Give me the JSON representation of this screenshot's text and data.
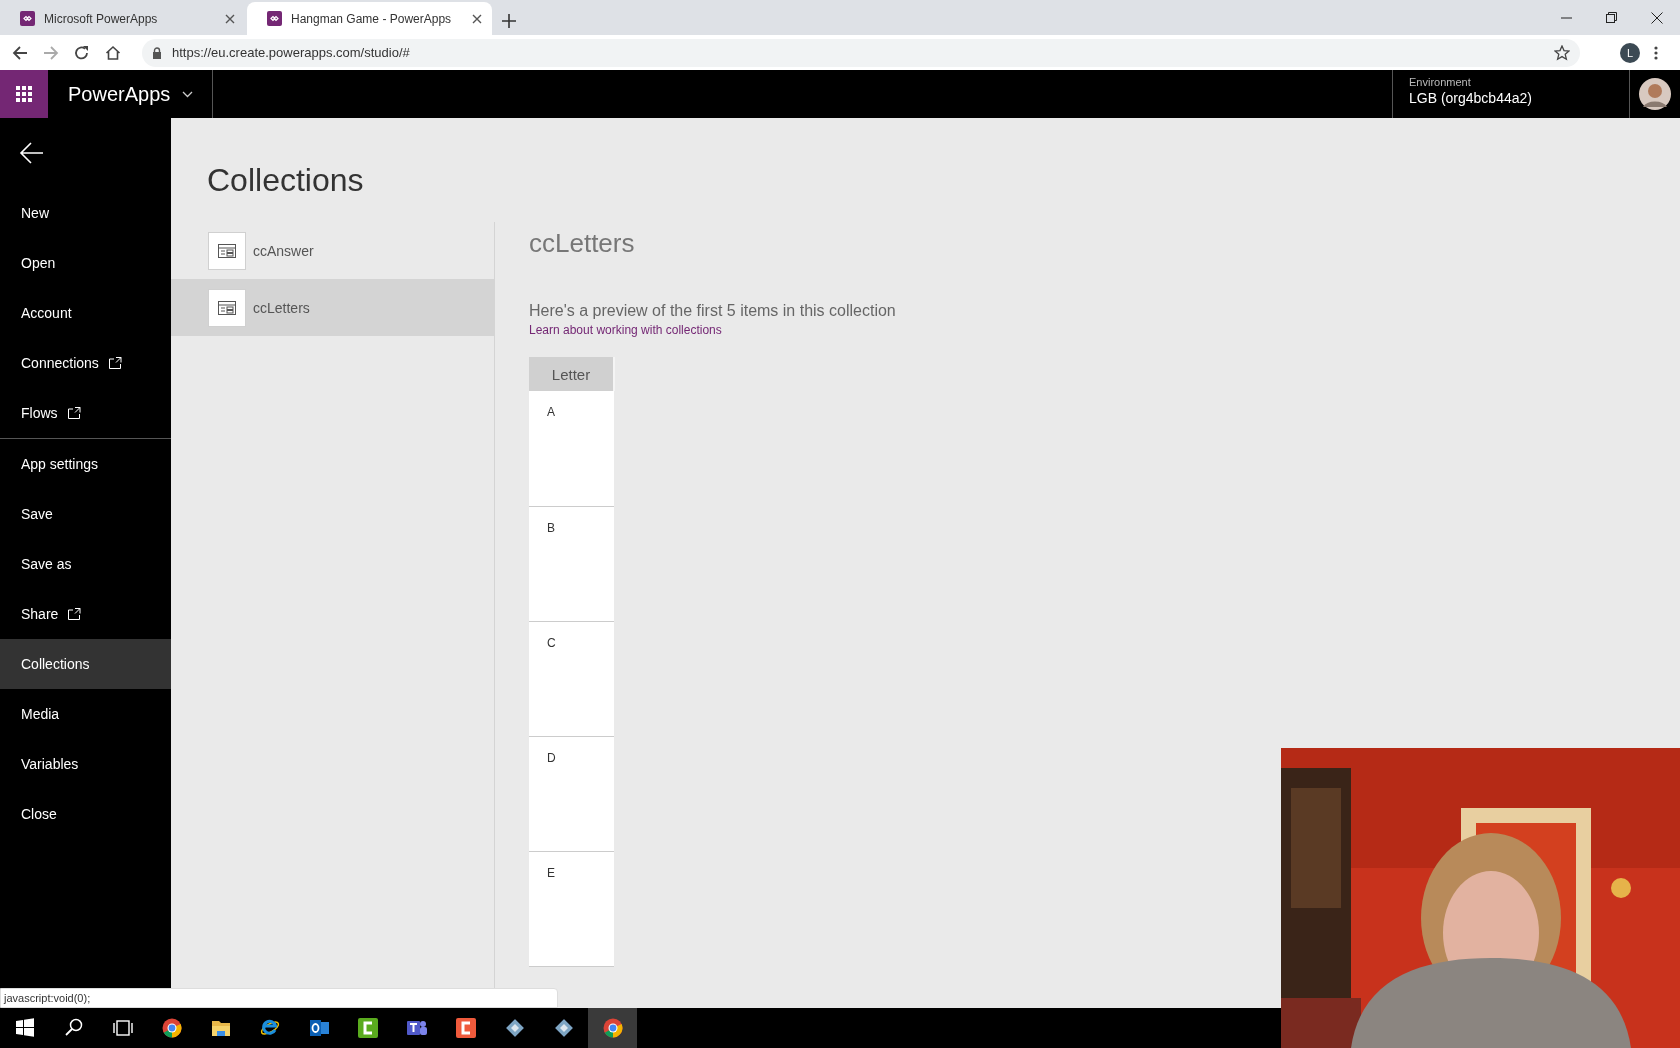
{
  "browser": {
    "tabs": [
      {
        "title": "Microsoft PowerApps",
        "selected": false
      },
      {
        "title": "Hangman Game - PowerApps",
        "selected": true
      }
    ],
    "url": "https://eu.create.powerapps.com/studio/#",
    "profile_initial": "L"
  },
  "header": {
    "app_name": "PowerApps",
    "environment_label": "Environment",
    "environment": "LGB (org4bcb44a2)"
  },
  "sidebar": {
    "groups": [
      [
        {
          "label": "New",
          "external": false,
          "selected": false
        },
        {
          "label": "Open",
          "external": false,
          "selected": false
        },
        {
          "label": "Account",
          "external": false,
          "selected": false
        },
        {
          "label": "Connections",
          "external": true,
          "selected": false
        },
        {
          "label": "Flows",
          "external": true,
          "selected": false
        }
      ],
      [
        {
          "label": "App settings",
          "external": false,
          "selected": false
        },
        {
          "label": "Save",
          "external": false,
          "selected": false
        },
        {
          "label": "Save as",
          "external": false,
          "selected": false
        },
        {
          "label": "Share",
          "external": true,
          "selected": false
        },
        {
          "label": "Collections",
          "external": false,
          "selected": true
        },
        {
          "label": "Media",
          "external": false,
          "selected": false
        },
        {
          "label": "Variables",
          "external": false,
          "selected": false
        },
        {
          "label": "Close",
          "external": false,
          "selected": false
        }
      ]
    ]
  },
  "page": {
    "title": "Collections",
    "collections": [
      {
        "name": "ccAnswer",
        "selected": false
      },
      {
        "name": "ccLetters",
        "selected": true
      }
    ],
    "detail": {
      "title": "ccLetters",
      "description": "Here's a preview of the first 5 items in this collection",
      "link": "Learn about working with collections",
      "columns": [
        "Letter"
      ],
      "rows": [
        [
          "A"
        ],
        [
          "B"
        ],
        [
          "C"
        ],
        [
          "D"
        ],
        [
          "E"
        ]
      ]
    }
  },
  "status_text": "javascript:void(0);",
  "taskbar": {
    "apps": [
      {
        "kind": "start",
        "selected": false
      },
      {
        "kind": "search",
        "selected": false
      },
      {
        "kind": "taskview",
        "selected": false
      },
      {
        "kind": "chrome",
        "selected": false
      },
      {
        "kind": "folder",
        "selected": false
      },
      {
        "kind": "ie",
        "selected": false
      },
      {
        "kind": "outlook",
        "selected": false
      },
      {
        "kind": "camtasia",
        "selected": false
      },
      {
        "kind": "teams",
        "selected": false
      },
      {
        "kind": "snagit",
        "selected": false
      },
      {
        "kind": "tool",
        "selected": false
      },
      {
        "kind": "tool",
        "selected": false
      },
      {
        "kind": "chrome",
        "selected": true
      }
    ]
  }
}
